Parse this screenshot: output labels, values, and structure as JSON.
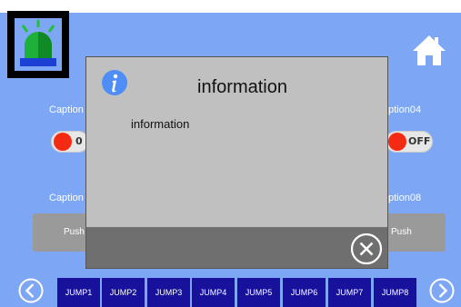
{
  "captions": {
    "left_top": "Caption",
    "right_top": "ption04",
    "left_bottom": "Caption",
    "right_bottom": "ption08"
  },
  "toggles": {
    "left_label": "0",
    "right_label": "OFF",
    "state_color": "#f52a12"
  },
  "push_buttons": {
    "left_label": "Push",
    "right_label": "Push"
  },
  "dialog": {
    "title": "information",
    "message": "information"
  },
  "nav": {
    "jumps": [
      "JUMP1",
      "JUMP2",
      "JUMP3",
      "JUMP4",
      "JUMP5",
      "JUMP6",
      "JUMP7",
      "JUMP8"
    ]
  },
  "icons": {
    "alarm": "alarm-beacon-icon",
    "home": "home-icon",
    "info": "info-icon",
    "close": "close-circle-icon",
    "prev": "chevron-left-icon",
    "next": "chevron-right-icon"
  },
  "colors": {
    "background": "#7da6f5",
    "jump_button": "#17119b",
    "beacon": "#1db13a"
  }
}
